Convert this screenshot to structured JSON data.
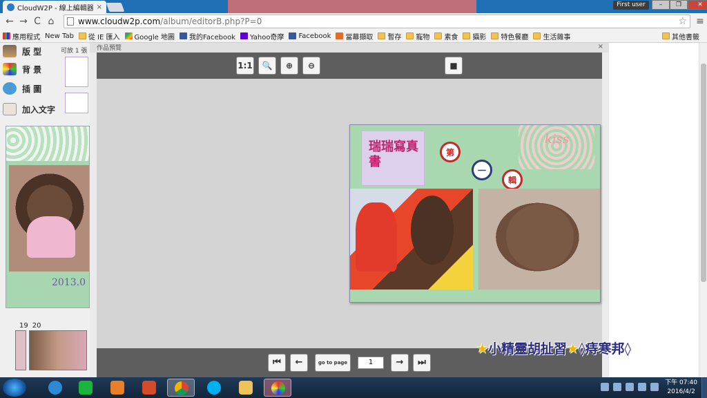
{
  "browser": {
    "tab_title": "CloudW2P - 線上編輯器",
    "tab_close": "×",
    "user_button": "First user",
    "window_buttons": [
      "–",
      "❐",
      "✕"
    ],
    "url_host": "www.cloudw2p.com",
    "url_path": "/album/editorB.php?P=0",
    "nav": {
      "back": "←",
      "forward": "→",
      "reload": "C",
      "home": "⌂"
    }
  },
  "bookmarks": {
    "items": [
      {
        "icon": "apps",
        "label": "應用程式"
      },
      {
        "icon": "page",
        "label": "New Tab"
      },
      {
        "icon": "folder",
        "label": "從 IE 匯入"
      },
      {
        "icon": "google",
        "label": "Google 地圖"
      },
      {
        "icon": "fb",
        "label": "我的Facebook"
      },
      {
        "icon": "yahoo",
        "label": "Yahoo奇摩"
      },
      {
        "icon": "fb",
        "label": "Facebook"
      },
      {
        "icon": "home",
        "label": "當幕擷取"
      },
      {
        "icon": "folder",
        "label": "暫存"
      },
      {
        "icon": "folder",
        "label": "寵物"
      },
      {
        "icon": "folder",
        "label": "素食"
      },
      {
        "icon": "folder",
        "label": "攝影"
      },
      {
        "icon": "folder",
        "label": "特色餐廳"
      },
      {
        "icon": "folder",
        "label": "生活雜事"
      }
    ],
    "other": "其他書籤"
  },
  "left_tools": {
    "items": [
      {
        "label": "版 型",
        "icon": "layout-icon"
      },
      {
        "label": "背 景",
        "icon": "background-palette-icon"
      },
      {
        "label": "插 圖",
        "icon": "illustration-bird-icon"
      },
      {
        "label": "加入文字",
        "icon": "add-text-icon"
      }
    ],
    "sub_label": "可放 1 張",
    "template_date": "2013.0",
    "page_numbers": [
      "19",
      "20"
    ]
  },
  "editor": {
    "header": "作品預覽",
    "close": "×",
    "top_buttons": [
      "1:1",
      "🔍",
      "⊕",
      "⊖"
    ],
    "stop_button": "■",
    "bottom_nav": {
      "first": "⏮",
      "prev": "←",
      "goto": "go to page",
      "page": "1",
      "next": "→",
      "last": "⏭"
    }
  },
  "album": {
    "title": "瑞瑞寫真書",
    "kiss": "kiss",
    "badges": [
      {
        "text": "第",
        "color": "#c02a2a"
      },
      {
        "text": "一",
        "color": "#2a3f7a"
      },
      {
        "text": "輯",
        "color": "#c02a2a"
      }
    ]
  },
  "watermark": {
    "star": "★",
    "text": "小精靈胡扯習",
    "star2": "★",
    "text2": "◊痔寒邦◊"
  },
  "taskbar": {
    "time": "下午 07:40",
    "date": "2016/4/2"
  },
  "colors": {
    "titlebar": "#1e6fb3",
    "editor_bar": "#5e5e5e",
    "album_bg": "#a9d7b0",
    "album_title": "#c0226e"
  }
}
